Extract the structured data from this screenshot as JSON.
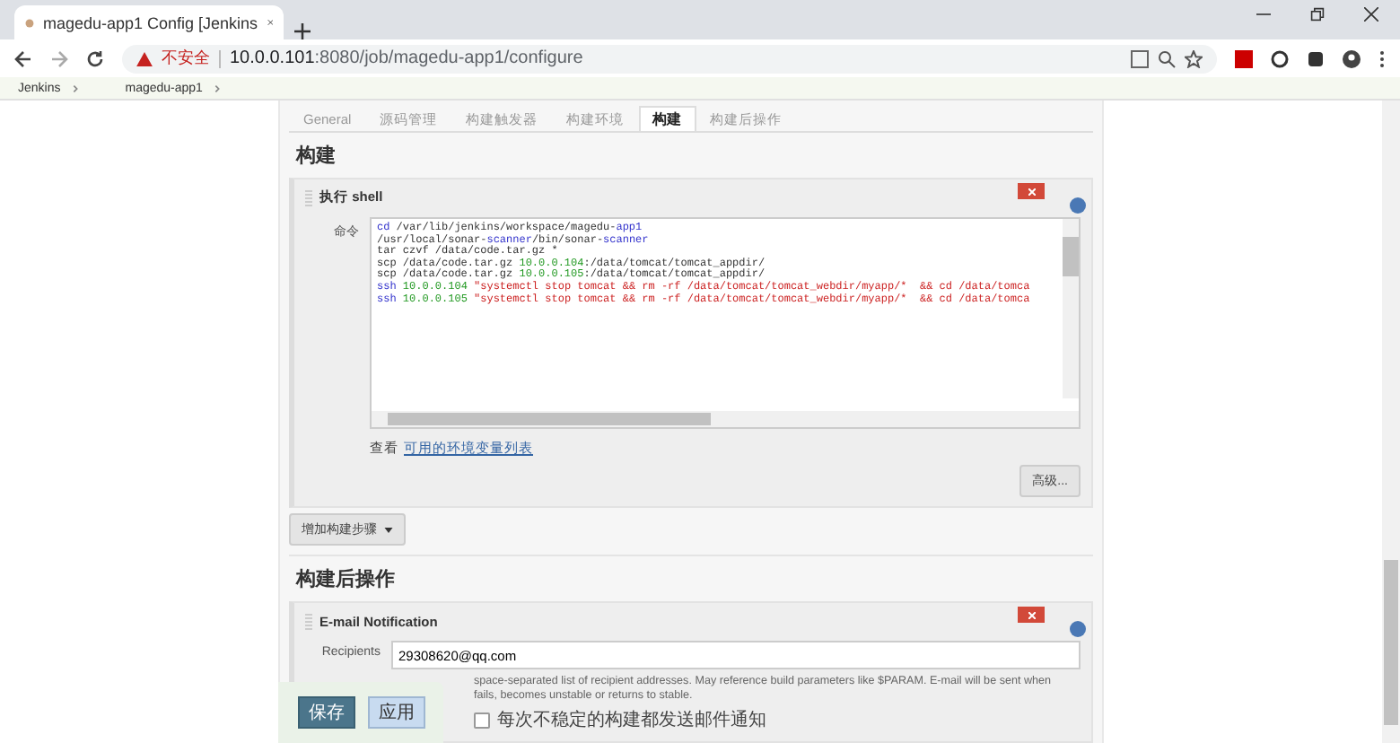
{
  "browser": {
    "tab_title": "magedu-app1 Config [Jenkins",
    "security_label": "不安全",
    "url_host": "10.0.0.101",
    "url_rest": ":8080/job/magedu-app1/configure"
  },
  "breadcrumbs": [
    "Jenkins",
    "magedu-app1"
  ],
  "tabs": [
    {
      "label": "General",
      "selected": false
    },
    {
      "label": "源码管理",
      "selected": false
    },
    {
      "label": "构建触发器",
      "selected": false
    },
    {
      "label": "构建环境",
      "selected": false
    },
    {
      "label": "构建",
      "selected": true
    },
    {
      "label": "构建后操作",
      "selected": false
    }
  ],
  "build": {
    "title": "构建",
    "step": {
      "title": "执行 shell",
      "command_label": "命令",
      "lines": [
        [
          {
            "kind": "cmd",
            "text": "cd"
          },
          {
            "kind": "plain",
            "text": " /var/lib/jenkins/workspace/magedu-"
          },
          {
            "kind": "cmd",
            "text": "app1"
          }
        ],
        [
          {
            "kind": "plain",
            "text": "/usr/local/sonar-"
          },
          {
            "kind": "cmd",
            "text": "scanner"
          },
          {
            "kind": "plain",
            "text": "/bin/sonar-"
          },
          {
            "kind": "cmd",
            "text": "scanner"
          }
        ],
        [
          {
            "kind": "plain",
            "text": "tar czvf /data/code.tar.gz *"
          }
        ],
        [
          {
            "kind": "plain",
            "text": "scp /data/code.tar.gz "
          },
          {
            "kind": "num",
            "text": "10.0.0.104"
          },
          {
            "kind": "plain",
            "text": ":/data/tomcat/tomcat_appdir/"
          }
        ],
        [
          {
            "kind": "plain",
            "text": "scp /data/code.tar.gz "
          },
          {
            "kind": "num",
            "text": "10.0.0.105"
          },
          {
            "kind": "plain",
            "text": ":/data/tomcat/tomcat_appdir/"
          }
        ],
        [
          {
            "kind": "cmd",
            "text": "ssh"
          },
          {
            "kind": "num",
            "text": " 10.0.0.104 "
          },
          {
            "kind": "str",
            "text": "\"systemctl stop tomcat && rm -rf /data/tomcat/tomcat_webdir/myapp/*  && cd /data/tomca"
          }
        ],
        [
          {
            "kind": "cmd",
            "text": "ssh"
          },
          {
            "kind": "num",
            "text": " 10.0.0.105 "
          },
          {
            "kind": "str",
            "text": "\"systemctl stop tomcat && rm -rf /data/tomcat/tomcat_webdir/myapp/*  && cd /data/tomca"
          }
        ]
      ],
      "env_prefix": "查看",
      "env_link": "可用的环境变量列表",
      "advanced_button": "高级..."
    },
    "add_step_button": "增加构建步骤"
  },
  "post_build": {
    "title": "构建后操作",
    "step": {
      "title": "E-mail Notification",
      "recipients_label": "Recipients",
      "recipients_value": "29308620@qq.com",
      "help": "space-separated list of recipient addresses. May reference build parameters like $PARAM. E-mail will be sent when",
      "help_2": "fails, becomes unstable or returns to stable.",
      "checkbox_label": "每次不稳定的构建都发送邮件通知",
      "checked": false
    }
  },
  "save_bar": {
    "save": "保存",
    "apply": "应用"
  }
}
